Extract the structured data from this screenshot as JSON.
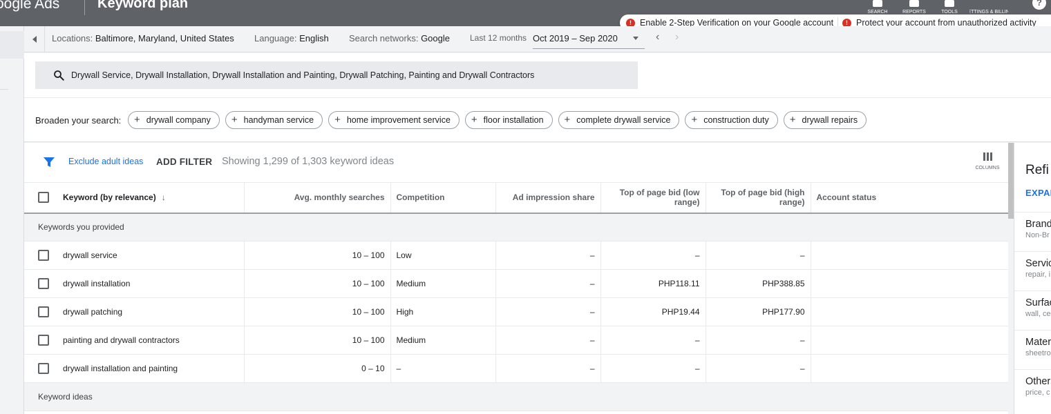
{
  "app": {
    "brand": "oogle Ads",
    "page_title": "Keyword plan",
    "nav": [
      {
        "label": "SEARCH",
        "icon": "search-icon"
      },
      {
        "label": "REPORTS",
        "icon": "reports-icon"
      },
      {
        "label": "TOOLS",
        "icon": "wrench-icon"
      },
      {
        "label": "SETTINGS & BILLING",
        "icon": "gear-icon"
      }
    ],
    "help_glyph": "?"
  },
  "notifications": [
    {
      "text": "Enable 2-Step Verification on your Google account"
    },
    {
      "text": "Protect your account from unauthorized activity"
    }
  ],
  "filters": {
    "locations_label": "Locations:",
    "locations_value": "Baltimore, Maryland, United States",
    "language_label": "Language:",
    "language_value": "English",
    "networks_label": "Search networks:",
    "networks_value": "Google",
    "date_label": "Last 12 months",
    "date_value": "Oct 2019 – Sep 2020"
  },
  "search": {
    "query": "Drywall Service, Drywall Installation, Drywall Installation and Painting, Drywall Patching, Painting and Drywall Contractors"
  },
  "broaden": {
    "label": "Broaden your search:",
    "chips": [
      "drywall company",
      "handyman service",
      "home improvement service",
      "floor installation",
      "complete drywall service",
      "construction duty",
      "drywall repairs"
    ]
  },
  "toolbar": {
    "exclude_adult": "Exclude adult ideas",
    "add_filter": "ADD FILTER",
    "showing": "Showing 1,299 of 1,303 keyword ideas",
    "columns_label": "COLUMNS"
  },
  "table": {
    "headers": {
      "keyword": "Keyword (by relevance)",
      "searches": "Avg. monthly searches",
      "competition": "Competition",
      "impression": "Ad impression share",
      "bid_low": "Top of page bid (low range)",
      "bid_high": "Top of page bid (high range)",
      "status": "Account status"
    },
    "group_provided": "Keywords you provided",
    "group_ideas": "Keyword ideas",
    "rows": [
      {
        "keyword": "drywall service",
        "searches": "10 – 100",
        "competition": "Low",
        "impression": "–",
        "bid_low": "–",
        "bid_high": "–",
        "status": ""
      },
      {
        "keyword": "drywall installation",
        "searches": "10 – 100",
        "competition": "Medium",
        "impression": "–",
        "bid_low": "PHP118.11",
        "bid_high": "PHP388.85",
        "status": ""
      },
      {
        "keyword": "drywall patching",
        "searches": "10 – 100",
        "competition": "High",
        "impression": "–",
        "bid_low": "PHP19.44",
        "bid_high": "PHP177.90",
        "status": ""
      },
      {
        "keyword": "painting and drywall contractors",
        "searches": "10 – 100",
        "competition": "Medium",
        "impression": "–",
        "bid_low": "–",
        "bid_high": "–",
        "status": ""
      },
      {
        "keyword": "drywall installation and painting",
        "searches": "0 – 10",
        "competition": "–",
        "impression": "–",
        "bid_low": "–",
        "bid_high": "–",
        "status": ""
      }
    ]
  },
  "refine": {
    "title": "Refi",
    "expand": "EXPAN",
    "items": [
      {
        "title": "Brand",
        "sub": "Non-Br"
      },
      {
        "title": "Servic",
        "sub": "repair, i"
      },
      {
        "title": "Surfac",
        "sub": "wall, ce"
      },
      {
        "title": "Mater",
        "sub": "sheetro"
      },
      {
        "title": "Others",
        "sub": "price, c"
      }
    ]
  }
}
